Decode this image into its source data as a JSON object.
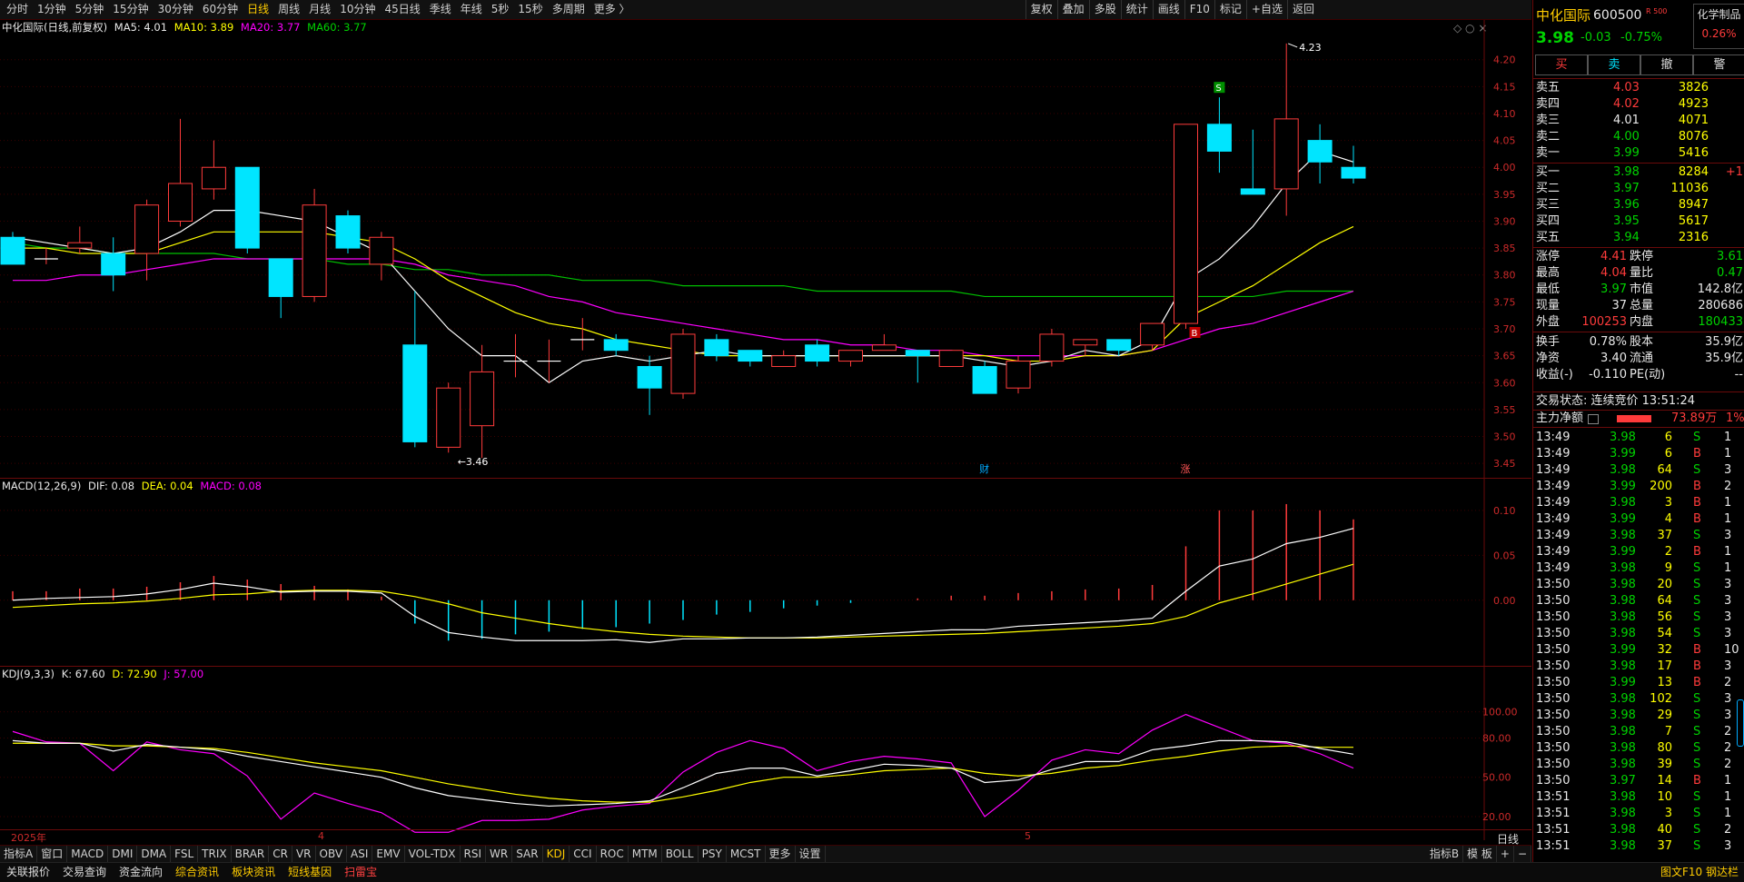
{
  "periods": [
    "分时",
    "1分钟",
    "5分钟",
    "15分钟",
    "30分钟",
    "60分钟",
    "日线",
    "周线",
    "月线",
    "10分钟",
    "45日线",
    "季线",
    "年线",
    "5秒",
    "15秒",
    "多周期",
    "更多 〉"
  ],
  "active_period": "日线",
  "tools": [
    "复权",
    "叠加",
    "多股",
    "统计",
    "画线",
    "F10",
    "标记",
    "+自选",
    "返回"
  ],
  "main_legend": {
    "title": "中化国际(日线,前复权)",
    "ma5": "MA5: 4.01",
    "ma10": "MA10: 3.89",
    "ma20": "MA20: 3.77",
    "ma60": "MA60: 3.77"
  },
  "macd_legend": {
    "title": "MACD(12,26,9)",
    "dif": "DIF: 0.08",
    "dea": "DEA: 0.04",
    "macd": "MACD: 0.08"
  },
  "kdj_legend": {
    "title": "KDJ(9,3,3)",
    "k": "K: 67.60",
    "d": "D: 72.90",
    "j": "J: 57.00"
  },
  "price_axis": [
    "4.20",
    "4.15",
    "4.10",
    "4.05",
    "4.00",
    "3.95",
    "3.90",
    "3.85",
    "3.80",
    "3.75",
    "3.70",
    "3.65",
    "3.60",
    "3.55",
    "3.50",
    "3.45"
  ],
  "macd_axis": [
    "0.10",
    "0.05",
    "0.00"
  ],
  "kdj_axis": [
    "100.00",
    "80.00",
    "50.00",
    "20.00"
  ],
  "annotations": {
    "high": "4.23",
    "low": "←3.46",
    "s_marker": "S",
    "b_marker": "B",
    "cai": "财",
    "zhang": "涨"
  },
  "date_axis": {
    "d1": "2025年",
    "d2": "4",
    "d3": "5",
    "period_label": "日线"
  },
  "indicator_tabs": [
    "指标A",
    "窗口",
    "MACD",
    "DMI",
    "DMA",
    "FSL",
    "TRIX",
    "BRAR",
    "CR",
    "VR",
    "OBV",
    "ASI",
    "EMV",
    "VOL-TDX",
    "RSI",
    "WR",
    "SAR",
    "KDJ",
    "CCI",
    "ROC",
    "MTM",
    "BOLL",
    "PSY",
    "MCST",
    "更多",
    "设置"
  ],
  "active_indicator": "KDJ",
  "indicator_right": [
    "指标B",
    "模 板",
    "+",
    "−"
  ],
  "statusbar": [
    "关联报价",
    "交易查询",
    "资金流向",
    "综合资讯",
    "板块资讯",
    "短线基因",
    "扫雷宝"
  ],
  "statusbar_right": "图文F10 钢达栏",
  "stock": {
    "name": "中化国际",
    "code": "600500",
    "tag": "R 500",
    "sector": "化学制品",
    "sector_pct": "0.26%",
    "price": "3.98",
    "change": "-0.03",
    "pct": "-0.75%"
  },
  "trade_buttons": [
    "买",
    "卖",
    "撤",
    "警"
  ],
  "asks": [
    {
      "label": "卖五",
      "price": "4.03",
      "vol": "3826"
    },
    {
      "label": "卖四",
      "price": "4.02",
      "vol": "4923"
    },
    {
      "label": "卖三",
      "price": "4.01",
      "vol": "4071"
    },
    {
      "label": "卖二",
      "price": "4.00",
      "vol": "8076"
    },
    {
      "label": "卖一",
      "price": "3.99",
      "vol": "5416"
    }
  ],
  "bids": [
    {
      "label": "买一",
      "price": "3.98",
      "vol": "8284",
      "extra": "+1"
    },
    {
      "label": "买二",
      "price": "3.97",
      "vol": "11036",
      "extra": ""
    },
    {
      "label": "买三",
      "price": "3.96",
      "vol": "8947",
      "extra": ""
    },
    {
      "label": "买四",
      "price": "3.95",
      "vol": "5617",
      "extra": ""
    },
    {
      "label": "买五",
      "price": "3.94",
      "vol": "2316",
      "extra": ""
    }
  ],
  "stats": [
    {
      "l1": "涨停",
      "v1": "4.41",
      "l2": "跌停",
      "v2": "3.61"
    },
    {
      "l1": "最高",
      "v1": "4.04",
      "l2": "量比",
      "v2": "0.47"
    },
    {
      "l1": "最低",
      "v1": "3.97",
      "l2": "市值",
      "v2": "142.8亿"
    },
    {
      "l1": "现量",
      "v1": "37",
      "l2": "总量",
      "v2": "280686"
    },
    {
      "l1": "外盘",
      "v1": "100253",
      "l2": "内盘",
      "v2": "180433"
    }
  ],
  "stats2": [
    {
      "l1": "换手",
      "v1": "0.78%",
      "l2": "股本",
      "v2": "35.9亿"
    },
    {
      "l1": "净资",
      "v1": "3.40",
      "l2": "流通",
      "v2": "35.9亿"
    },
    {
      "l1": "收益(-)",
      "v1": "-0.110",
      "l2": "PE(动)",
      "v2": "--"
    }
  ],
  "trade_status": "交易状态: 连续竞价 13:51:24",
  "main_flow": {
    "label": "主力净额",
    "value": "73.89万",
    "pct": "1%"
  },
  "ticks": [
    [
      "13:49",
      "3.98",
      "6",
      "S",
      "1"
    ],
    [
      "13:49",
      "3.99",
      "6",
      "B",
      "1"
    ],
    [
      "13:49",
      "3.98",
      "64",
      "S",
      "3"
    ],
    [
      "13:49",
      "3.99",
      "200",
      "B",
      "2"
    ],
    [
      "13:49",
      "3.98",
      "3",
      "B",
      "1"
    ],
    [
      "13:49",
      "3.99",
      "4",
      "B",
      "1"
    ],
    [
      "13:49",
      "3.98",
      "37",
      "S",
      "3"
    ],
    [
      "13:49",
      "3.99",
      "2",
      "B",
      "1"
    ],
    [
      "13:49",
      "3.98",
      "9",
      "S",
      "1"
    ],
    [
      "13:50",
      "3.98",
      "20",
      "S",
      "3"
    ],
    [
      "13:50",
      "3.98",
      "64",
      "S",
      "3"
    ],
    [
      "13:50",
      "3.98",
      "56",
      "S",
      "3"
    ],
    [
      "13:50",
      "3.98",
      "54",
      "S",
      "3"
    ],
    [
      "13:50",
      "3.99",
      "32",
      "B",
      "10"
    ],
    [
      "13:50",
      "3.98",
      "17",
      "B",
      "3"
    ],
    [
      "13:50",
      "3.99",
      "13",
      "B",
      "2"
    ],
    [
      "13:50",
      "3.98",
      "102",
      "S",
      "3"
    ],
    [
      "13:50",
      "3.98",
      "29",
      "S",
      "3"
    ],
    [
      "13:50",
      "3.98",
      "7",
      "S",
      "2"
    ],
    [
      "13:50",
      "3.98",
      "80",
      "S",
      "2"
    ],
    [
      "13:50",
      "3.98",
      "39",
      "S",
      "2"
    ],
    [
      "13:50",
      "3.97",
      "14",
      "B",
      "1"
    ],
    [
      "13:51",
      "3.98",
      "10",
      "S",
      "1"
    ],
    [
      "13:51",
      "3.98",
      "3",
      "S",
      "1"
    ],
    [
      "13:51",
      "3.98",
      "40",
      "S",
      "2"
    ],
    [
      "13:51",
      "3.98",
      "37",
      "S",
      "3"
    ]
  ],
  "colors": {
    "up": "#ff3b3b",
    "down": "#00e5ff",
    "ma5": "#ffffff",
    "ma10": "#ffff00",
    "ma20": "#ff00ff",
    "ma60": "#00c000"
  },
  "chart_data": {
    "type": "candlestick",
    "title": "中化国际(日线,前复权)",
    "ylim": [
      3.43,
      4.24
    ],
    "candles": [
      [
        3.87,
        3.88,
        3.83,
        3.82
      ],
      [
        3.83,
        3.85,
        3.82,
        3.83
      ],
      [
        3.85,
        3.89,
        3.84,
        3.86
      ],
      [
        3.84,
        3.87,
        3.77,
        3.8
      ],
      [
        3.84,
        3.94,
        3.79,
        3.93
      ],
      [
        3.9,
        4.09,
        3.89,
        3.97
      ],
      [
        3.96,
        4.05,
        3.94,
        4.0
      ],
      [
        4.0,
        4.0,
        3.84,
        3.85
      ],
      [
        3.83,
        3.83,
        3.72,
        3.76
      ],
      [
        3.76,
        3.96,
        3.75,
        3.93
      ],
      [
        3.91,
        3.92,
        3.84,
        3.85
      ],
      [
        3.82,
        3.88,
        3.79,
        3.87
      ],
      [
        3.67,
        3.77,
        3.48,
        3.49
      ],
      [
        3.48,
        3.6,
        3.47,
        3.59
      ],
      [
        3.52,
        3.67,
        3.46,
        3.62
      ],
      [
        3.64,
        3.69,
        3.61,
        3.64
      ],
      [
        3.64,
        3.68,
        3.6,
        3.64
      ],
      [
        3.68,
        3.72,
        3.66,
        3.68
      ],
      [
        3.68,
        3.69,
        3.65,
        3.66
      ],
      [
        3.63,
        3.65,
        3.54,
        3.59
      ],
      [
        3.58,
        3.7,
        3.57,
        3.69
      ],
      [
        3.68,
        3.69,
        3.64,
        3.65
      ],
      [
        3.66,
        3.66,
        3.63,
        3.64
      ],
      [
        3.63,
        3.66,
        3.63,
        3.65
      ],
      [
        3.67,
        3.68,
        3.63,
        3.64
      ],
      [
        3.64,
        3.66,
        3.63,
        3.66
      ],
      [
        3.66,
        3.69,
        3.66,
        3.67
      ],
      [
        3.66,
        3.66,
        3.6,
        3.65
      ],
      [
        3.63,
        3.66,
        3.63,
        3.66
      ],
      [
        3.63,
        3.64,
        3.58,
        3.58
      ],
      [
        3.59,
        3.65,
        3.58,
        3.64
      ],
      [
        3.64,
        3.7,
        3.63,
        3.69
      ],
      [
        3.67,
        3.68,
        3.65,
        3.68
      ],
      [
        3.68,
        3.68,
        3.65,
        3.66
      ],
      [
        3.67,
        3.71,
        3.66,
        3.71
      ],
      [
        3.71,
        4.08,
        3.7,
        4.08
      ],
      [
        4.08,
        4.13,
        3.99,
        4.03
      ],
      [
        3.96,
        4.07,
        3.95,
        3.95
      ],
      [
        3.96,
        4.23,
        3.91,
        4.09
      ],
      [
        4.05,
        4.08,
        3.97,
        4.01
      ],
      [
        4.0,
        4.04,
        3.97,
        3.98
      ]
    ],
    "ma5": [
      3.87,
      3.86,
      3.85,
      3.84,
      3.85,
      3.88,
      3.92,
      3.92,
      3.91,
      3.9,
      3.87,
      3.84,
      3.77,
      3.7,
      3.65,
      3.65,
      3.6,
      3.64,
      3.65,
      3.64,
      3.65,
      3.66,
      3.65,
      3.65,
      3.65,
      3.65,
      3.65,
      3.65,
      3.65,
      3.64,
      3.63,
      3.64,
      3.66,
      3.65,
      3.68,
      3.79,
      3.83,
      3.89,
      3.97,
      4.03,
      4.01
    ],
    "ma10": [
      3.85,
      3.85,
      3.84,
      3.84,
      3.84,
      3.86,
      3.88,
      3.88,
      3.88,
      3.88,
      3.87,
      3.86,
      3.83,
      3.79,
      3.76,
      3.73,
      3.71,
      3.7,
      3.68,
      3.67,
      3.66,
      3.65,
      3.65,
      3.65,
      3.65,
      3.65,
      3.65,
      3.65,
      3.65,
      3.65,
      3.64,
      3.64,
      3.65,
      3.65,
      3.66,
      3.72,
      3.75,
      3.78,
      3.82,
      3.86,
      3.89
    ],
    "ma20": [
      3.79,
      3.79,
      3.8,
      3.8,
      3.81,
      3.82,
      3.83,
      3.83,
      3.83,
      3.83,
      3.83,
      3.83,
      3.82,
      3.8,
      3.79,
      3.78,
      3.76,
      3.75,
      3.73,
      3.72,
      3.71,
      3.7,
      3.69,
      3.68,
      3.68,
      3.67,
      3.67,
      3.66,
      3.66,
      3.65,
      3.65,
      3.65,
      3.65,
      3.65,
      3.66,
      3.68,
      3.7,
      3.71,
      3.73,
      3.75,
      3.77
    ],
    "ma60": [
      3.86,
      3.85,
      3.85,
      3.84,
      3.84,
      3.84,
      3.84,
      3.83,
      3.83,
      3.83,
      3.82,
      3.82,
      3.81,
      3.81,
      3.8,
      3.8,
      3.8,
      3.79,
      3.79,
      3.79,
      3.78,
      3.78,
      3.78,
      3.78,
      3.77,
      3.77,
      3.77,
      3.77,
      3.77,
      3.76,
      3.76,
      3.76,
      3.76,
      3.76,
      3.76,
      3.76,
      3.76,
      3.76,
      3.77,
      3.77,
      3.77
    ],
    "macd_ylim": [
      -0.07,
      0.11
    ],
    "macd_hist": [
      0.01,
      0.01,
      0.013,
      0.013,
      0.015,
      0.02,
      0.027,
      0.023,
      0.018,
      0.016,
      0.012,
      0.004,
      -0.026,
      -0.045,
      -0.043,
      -0.038,
      -0.035,
      -0.032,
      -0.03,
      -0.026,
      -0.022,
      -0.016,
      -0.013,
      -0.009,
      -0.006,
      -0.003,
      0.0,
      0.002,
      0.005,
      0.005,
      0.008,
      0.01,
      0.012,
      0.013,
      0.017,
      0.06,
      0.1,
      0.1,
      0.107,
      0.1,
      0.09
    ],
    "dif": [
      0.0,
      0.002,
      0.003,
      0.004,
      0.007,
      0.012,
      0.019,
      0.015,
      0.009,
      0.01,
      0.01,
      0.008,
      -0.018,
      -0.036,
      -0.041,
      -0.045,
      -0.045,
      -0.045,
      -0.044,
      -0.047,
      -0.043,
      -0.043,
      -0.042,
      -0.042,
      -0.041,
      -0.039,
      -0.037,
      -0.035,
      -0.033,
      -0.033,
      -0.029,
      -0.027,
      -0.025,
      -0.023,
      -0.02,
      0.01,
      0.038,
      0.046,
      0.063,
      0.07,
      0.08
    ],
    "dea": [
      -0.008,
      -0.006,
      -0.004,
      -0.003,
      -0.001,
      0.002,
      0.006,
      0.007,
      0.01,
      0.011,
      0.011,
      0.01,
      0.004,
      -0.004,
      -0.014,
      -0.02,
      -0.026,
      -0.031,
      -0.035,
      -0.038,
      -0.04,
      -0.041,
      -0.042,
      -0.042,
      -0.042,
      -0.041,
      -0.04,
      -0.039,
      -0.038,
      -0.037,
      -0.035,
      -0.033,
      -0.031,
      -0.029,
      -0.026,
      -0.018,
      -0.003,
      0.007,
      0.018,
      0.029,
      0.04
    ],
    "kdj_ylim": [
      -5,
      115
    ],
    "k": [
      78,
      76,
      76,
      70,
      75,
      73,
      71,
      66,
      62,
      58,
      54,
      50,
      42,
      36,
      33,
      30,
      28,
      29,
      30,
      32,
      42,
      53,
      57,
      57,
      51,
      55,
      60,
      59,
      57,
      46,
      48,
      56,
      62,
      62,
      71,
      74,
      78,
      78,
      77,
      72,
      67.6
    ],
    "d": [
      76,
      76,
      76,
      74,
      74,
      73,
      72,
      69,
      65,
      61,
      58,
      55,
      50,
      45,
      41,
      37,
      34,
      32,
      31,
      31,
      35,
      40,
      46,
      50,
      50,
      52,
      55,
      56,
      57,
      53,
      51,
      53,
      57,
      59,
      63,
      66,
      70,
      73,
      74,
      73,
      72.9
    ],
    "j": [
      85,
      77,
      76,
      55,
      77,
      71,
      68,
      51,
      18,
      38,
      30,
      23,
      8,
      8,
      17,
      17,
      18,
      25,
      28,
      30,
      54,
      69,
      78,
      72,
      55,
      62,
      66,
      64,
      61,
      20,
      40,
      63,
      71,
      68,
      86,
      98,
      88,
      78,
      76,
      68,
      57.0
    ]
  }
}
